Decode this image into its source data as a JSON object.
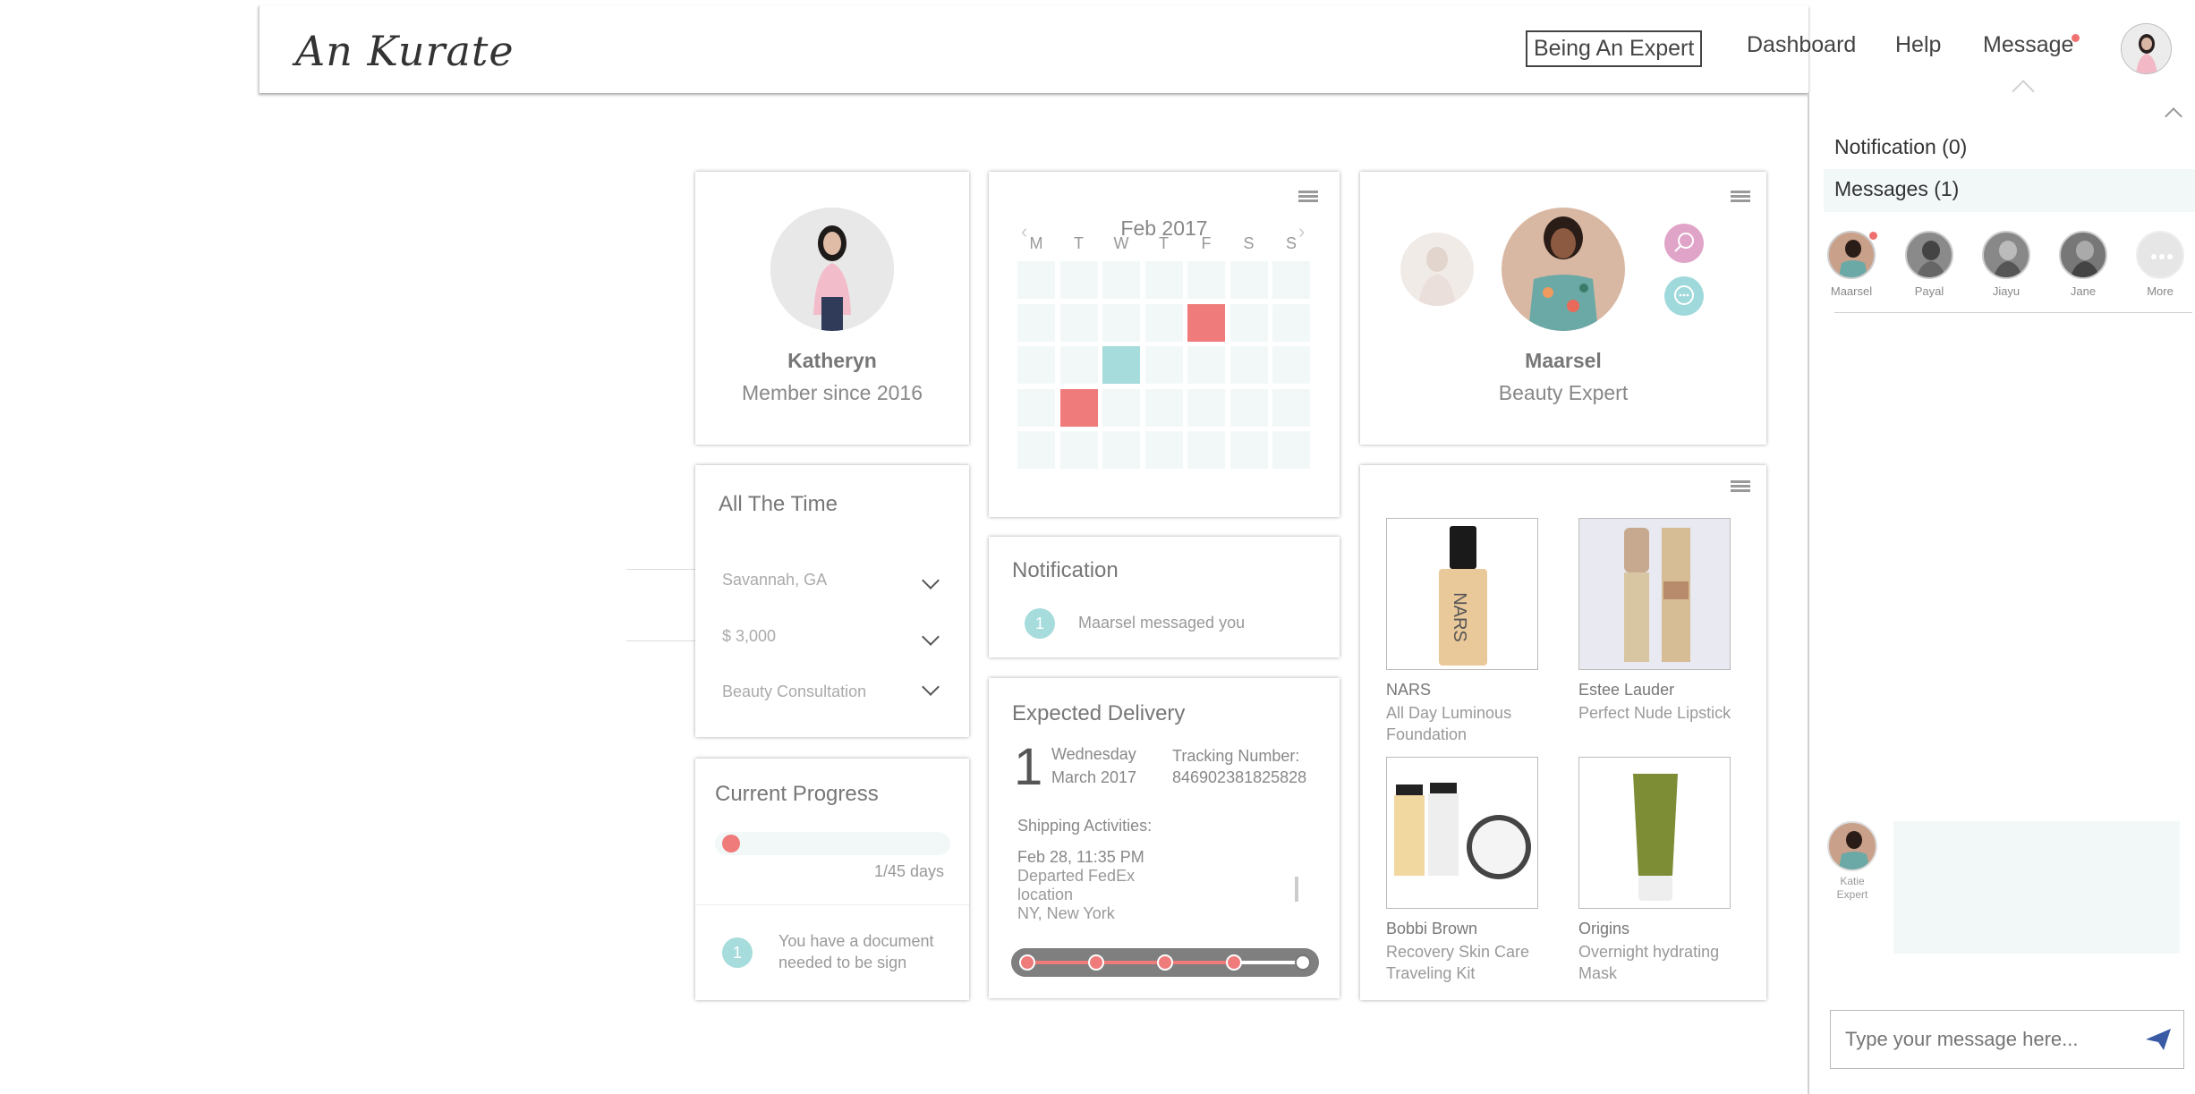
{
  "header": {
    "logo": "An Kurate",
    "nav": {
      "expert": "Being An Expert",
      "dashboard": "Dashboard",
      "help": "Help",
      "message": "Message"
    }
  },
  "profile": {
    "name": "Katheryn",
    "since": "Member since 2016"
  },
  "calendar": {
    "month": "Feb 2017",
    "days": [
      "M",
      "T",
      "W",
      "T",
      "F",
      "S",
      "S"
    ],
    "highlights": [
      {
        "row": 2,
        "col": 5,
        "color": "#ef7b7b"
      },
      {
        "row": 3,
        "col": 3,
        "color": "#a7dcdc"
      },
      {
        "row": 4,
        "col": 2,
        "color": "#ef7b7b"
      }
    ]
  },
  "expert": {
    "name": "Maarsel",
    "role": "Beauty Expert"
  },
  "filters": {
    "title": "All The Time",
    "location": "Savannah, GA",
    "budget": "$ 3,000",
    "service": "Beauty Consultation"
  },
  "notification": {
    "title": "Notification",
    "count": "1",
    "text": "Maarsel messaged you"
  },
  "delivery": {
    "title": "Expected Delivery",
    "day": "1",
    "weekday": "Wednesday",
    "monthyear": "March 2017",
    "tracking_label": "Tracking Number:",
    "tracking_number": "846902381825828",
    "activities_label": "Shipping Activities:",
    "activity_time": "Feb 28, 11:35 PM",
    "activity_line1": "Departed FedEx",
    "activity_line2": "location",
    "activity_place": "NY, New York",
    "progress_steps": 5,
    "progress_done": 4
  },
  "products": [
    {
      "brand": "NARS",
      "name": "All Day Luminous Foundation"
    },
    {
      "brand": "Estee Lauder",
      "name": "Perfect Nude Lipstick"
    },
    {
      "brand": "Bobbi Brown",
      "name": "Recovery Skin Care Traveling Kit"
    },
    {
      "brand": "Origins",
      "name": "Overnight hydrating Mask"
    }
  ],
  "progress": {
    "title": "Current Progress",
    "value": 0.022,
    "days": "1/45 days",
    "count": "1",
    "doc_text_1": "You have a document",
    "doc_text_2": "needed to be sign"
  },
  "side": {
    "notifications": "Notification (0)",
    "messages": "Messages (1)",
    "contacts": [
      "Maarsel",
      "Payal",
      "Jiayu",
      "Jane",
      "More"
    ],
    "chat_name_1": "Katie",
    "chat_name_2": "Expert",
    "input_placeholder": "Type your message here..."
  },
  "colors": {
    "accent_red": "#ef7b7b",
    "accent_teal": "#a7dcdc",
    "expert_pink": "#e0a4c8",
    "expert_teal": "#9fd9db"
  }
}
